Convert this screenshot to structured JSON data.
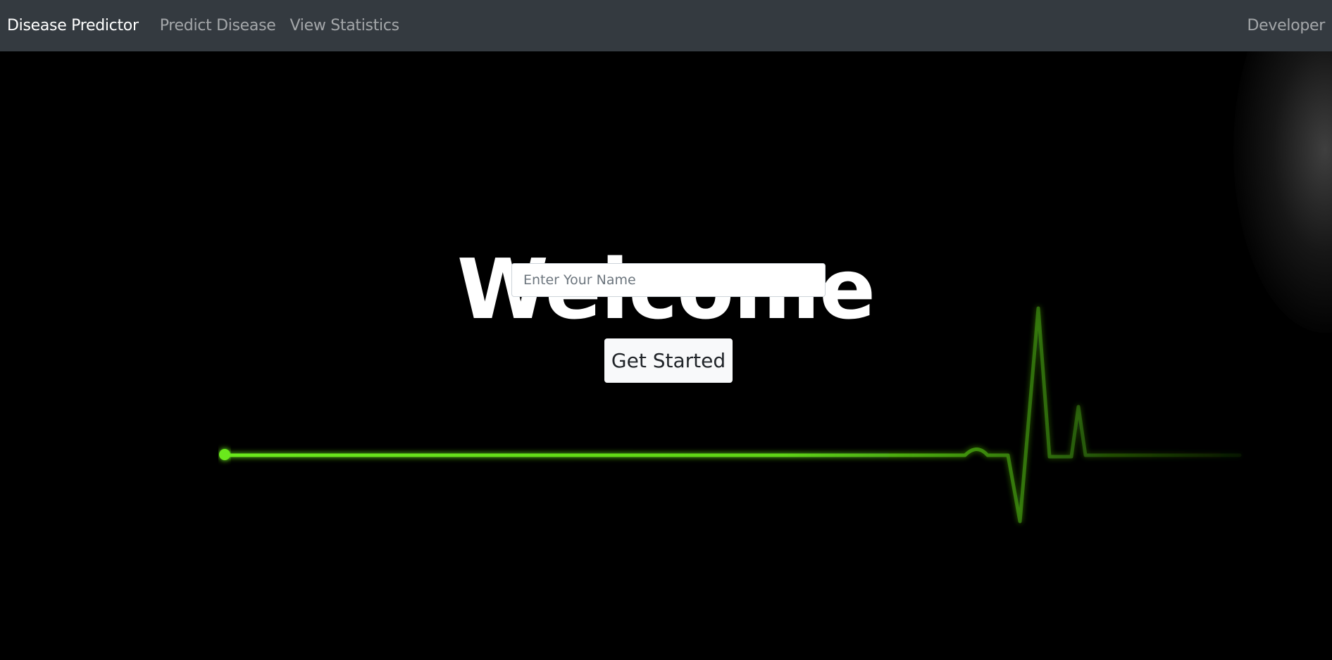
{
  "navbar": {
    "brand": "Disease Predictor",
    "links": [
      "Predict Disease",
      "View Statistics"
    ],
    "right_link": "Developer",
    "background": "#343a40"
  },
  "hero": {
    "title": "Welcome",
    "name_input": {
      "value": "",
      "placeholder": "Enter Your Name"
    },
    "start_button": "Get Started",
    "ecg_color": "#6be81c",
    "ecg_icon": "heartbeat-line"
  }
}
